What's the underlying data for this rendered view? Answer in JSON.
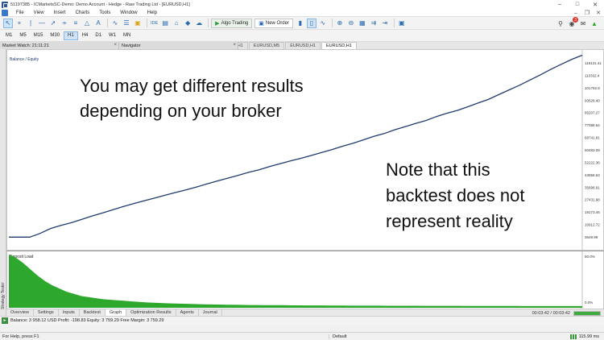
{
  "window": {
    "title": "51197385 - ICMarketsSC-Demo: Demo Account - Hedge - Raw Trading Ltd - [EURUSD,H1]"
  },
  "menu": {
    "items": [
      "File",
      "View",
      "Insert",
      "Charts",
      "Tools",
      "Window",
      "Help"
    ]
  },
  "toolbar": {
    "algo_trading_label": "Algo Trading",
    "new_order_label": "New Order",
    "ide_label": "IDE",
    "notification_count": "3"
  },
  "timeframes": {
    "items": [
      "M1",
      "M5",
      "M15",
      "M30",
      "H1",
      "H4",
      "D1",
      "W1",
      "MN"
    ],
    "active": "H1"
  },
  "panels": {
    "market_watch": "Market Watch: 21:11:21",
    "navigator": "Navigator"
  },
  "chart_tabs": {
    "items": [
      "EURUSD,H1",
      "EURUSD,M5",
      "EURUSD,H1",
      "EURUSD,H1"
    ],
    "active_index": 3
  },
  "side_strip_label": "Strategy Tester",
  "chart_data": [
    {
      "type": "line",
      "title": "Balance / Equity",
      "xlabel": "",
      "ylabel": "",
      "series": [
        {
          "color": "#1f3b6e",
          "values": [
            3750,
            3760,
            3770,
            6000,
            9000,
            10900,
            12500,
            14500,
            16600,
            18400,
            20400,
            22300,
            24100,
            25800,
            27500,
            29200,
            30800,
            32400,
            34100,
            36000,
            37800,
            39500,
            41200,
            43000,
            44500,
            46500,
            48200,
            49900,
            51500,
            53200,
            55000,
            56800,
            58800,
            60600,
            62700,
            64800,
            66500,
            68800,
            70700,
            72600,
            74400,
            76800,
            78800,
            80500,
            82700,
            85000,
            87200,
            90100,
            93000,
            95800,
            99000,
            102100,
            105500,
            108500,
            111500,
            114000
          ]
        }
      ],
      "y_tick_labels": [
        "118131.41",
        "110332.4",
        "101792.8",
        "93528.40",
        "85207.27",
        "77089.54",
        "68741.81",
        "60483.09",
        "52222.36",
        "43958.63",
        "35698.91",
        "27431.98",
        "19173.46",
        "10912.72",
        "3649.99"
      ],
      "ylim": [
        0,
        118131.41
      ],
      "grid": false
    },
    {
      "type": "area",
      "title": "Deposit Load",
      "series": [
        {
          "color": "#2da82d",
          "values": [
            50,
            47,
            42,
            36,
            30,
            25,
            21,
            18,
            15,
            13,
            11,
            10,
            9,
            8,
            7.5,
            7,
            6.5,
            6,
            5.5,
            5,
            4.8,
            4.5,
            4.2,
            4,
            3.8,
            3.6,
            3.4,
            3.2,
            3.1,
            3,
            2.9,
            2.8,
            2.7,
            2.6,
            2.6,
            2.5,
            2.5,
            2.4,
            2.4,
            2.3,
            2.3,
            2.2,
            2.2,
            2.2,
            2.1,
            2.1,
            2.1,
            2,
            2,
            2,
            2,
            2,
            1.9,
            1.9,
            1.9,
            1.9,
            1.9,
            1.8,
            1.8,
            1.8,
            1.8,
            1.8,
            1.8,
            1.7,
            1.7,
            1.7,
            1.7,
            1.7,
            1.7,
            1.7,
            1.7,
            1.6,
            1.6,
            1.6,
            1.6,
            1.6,
            1.6,
            1.6,
            1.6,
            1.6
          ]
        }
      ],
      "y_tick_labels": [
        "50.0%",
        "0.0%"
      ],
      "ylim": [
        0,
        50
      ],
      "x_tick_labels": [
        "2020.06.17",
        "2020.08.05",
        "2020.09.14",
        "2020.10.21",
        "2020.12.11",
        "2021.02.04",
        "2021.05.31",
        "2021.11.23",
        "2022.03.07",
        "2022.05.02",
        "2022.06.09",
        "2022.07.09",
        "2022.08.02",
        "2022.09.08",
        "2022.09.27",
        "2022.10.07",
        "2022.10.24",
        "2022.11.11",
        "2022.12.09",
        "2023.01.19",
        "2023.03.09",
        "2023.05.12",
        "2023.10.02"
      ]
    }
  ],
  "annotations": {
    "top": "You may get different results depending on your broker",
    "right": "Note that this backtest does not represent reality"
  },
  "tester": {
    "tabs": [
      "Overview",
      "Settings",
      "Inputs",
      "Backtest",
      "Graph",
      "Optimization Results",
      "Agents",
      "Journal"
    ],
    "active": "Graph",
    "elapsed": "00:03:42",
    "remaining": "00:03:42",
    "progress": 1.0
  },
  "balance_line": "Balance: 3 958.12 USD  Profit: -198.83  Equity: 3 759.29  Free Margin: 3 759.29",
  "status": {
    "help": "For Help, press F1",
    "profile": "Default",
    "network": "115.99 ms"
  }
}
